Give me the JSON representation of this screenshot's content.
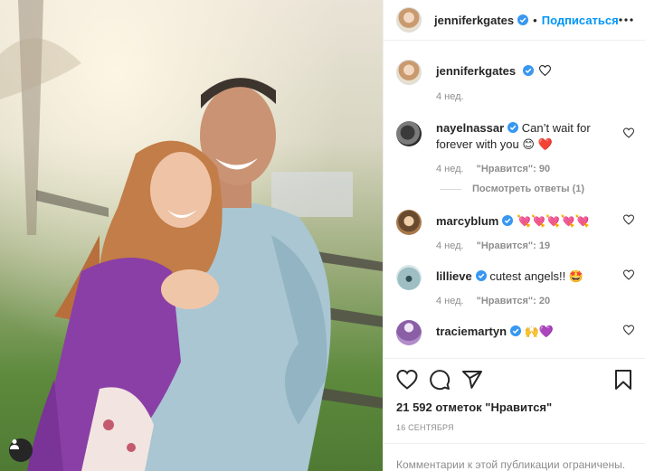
{
  "header": {
    "username": "jenniferkgates",
    "separator": "•",
    "follow_label": "Подписаться"
  },
  "caption": {
    "username": "jenniferkgates",
    "time": "4 нед."
  },
  "comments": [
    {
      "username": "nayelnassar",
      "text": "Can’t wait for forever with you 😊 ❤️",
      "time": "4 нед.",
      "likes": "\"Нравится\": 90"
    },
    {
      "username": "marcyblum",
      "text": "💘💘💘💘💘",
      "time": "4 нед.",
      "likes": "\"Нравится\": 19"
    },
    {
      "username": "lillieve",
      "text": "cutest angels!! 🤩",
      "time": "4 нед.",
      "likes": "\"Нравится\": 20"
    },
    {
      "username": "traciemartyn",
      "text": "🙌💜",
      "time": "",
      "likes": ""
    }
  ],
  "view_replies": "Посмотреть ответы (1)",
  "likes_count": "21 592 отметок \"Нравится\"",
  "date": "16 СЕНТЯБРЯ",
  "comments_closed": "Комментарии к этой публикации ограничены.",
  "colors": {
    "link": "#0095f6",
    "verified": "#3897f0",
    "muted": "#8e8e8e",
    "heart_red": "#ed4956"
  }
}
